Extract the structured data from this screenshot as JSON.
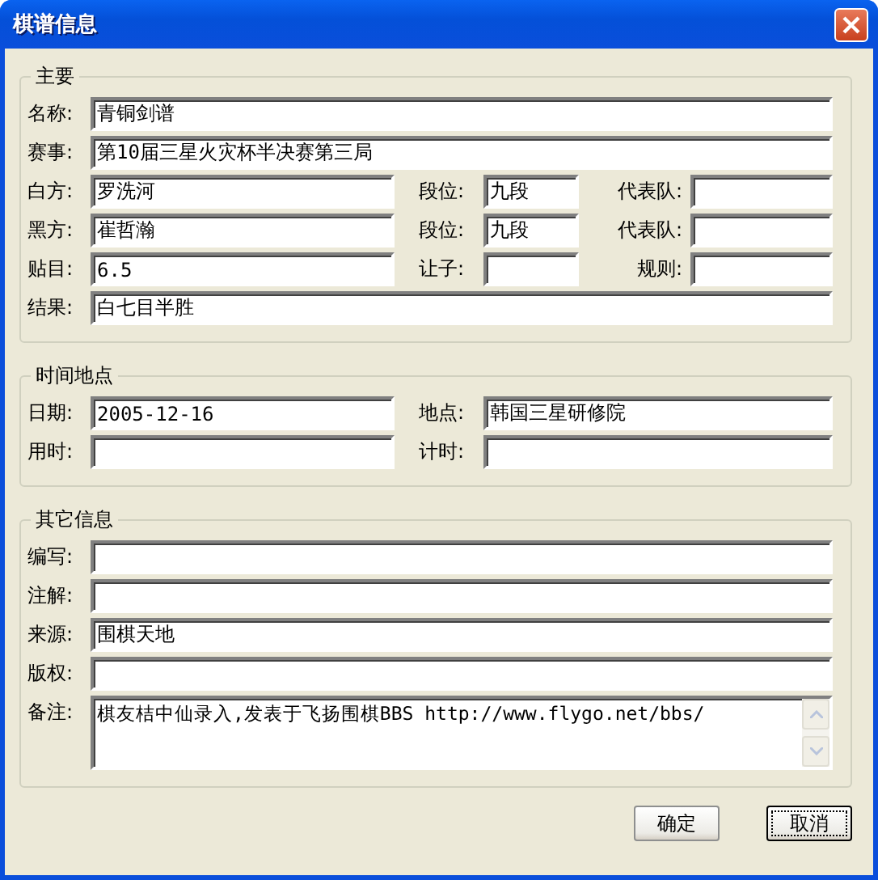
{
  "window": {
    "title": "棋谱信息"
  },
  "groups": [
    {
      "title": "主要",
      "rows": [
        {
          "fields": [
            {
              "label": "名称:",
              "value": "青铜剑谱"
            }
          ]
        },
        {
          "fields": [
            {
              "label": "赛事:",
              "value": "第10届三星火灾杯半决赛第三局"
            }
          ]
        },
        {
          "fields": [
            {
              "label": "白方:",
              "value": "罗洗河"
            },
            {
              "label": "段位:",
              "value": "九段"
            },
            {
              "label": "代表队:"
            }
          ]
        },
        {
          "fields": [
            {
              "label": "黑方:",
              "value": "崔哲瀚"
            },
            {
              "label": "段位:",
              "value": "九段"
            },
            {
              "label": "代表队:"
            }
          ]
        },
        {
          "fields": [
            {
              "label": "贴目:",
              "value": "6.5"
            },
            {
              "label": "让子:"
            },
            {
              "label": "规则:"
            }
          ]
        },
        {
          "fields": [
            {
              "label": "结果:",
              "value": "白七目半胜"
            }
          ]
        }
      ]
    },
    {
      "title": "时间地点",
      "rows": [
        {
          "fields": [
            {
              "label": "日期:",
              "value": "2005-12-16"
            },
            {
              "label": "地点:",
              "value": "韩国三星研修院"
            }
          ]
        },
        {
          "fields": [
            {
              "label": "用时:"
            },
            {
              "label": "计时:"
            }
          ]
        }
      ]
    },
    {
      "title": "其它信息",
      "rows": [
        {
          "fields": [
            {
              "label": "编写:"
            }
          ]
        },
        {
          "fields": [
            {
              "label": "注解:"
            }
          ]
        },
        {
          "fields": [
            {
              "label": "来源:",
              "value": "围棋天地"
            }
          ]
        },
        {
          "fields": [
            {
              "label": "版权:"
            }
          ]
        },
        {
          "fields": [
            {
              "label": "备注:",
              "value": "棋友桔中仙录入,发表于飞扬围棋BBS http://www.flygo.net/bbs/",
              "kind": "memo"
            }
          ]
        }
      ]
    }
  ],
  "buttons": [
    {
      "label": "确定",
      "focused": false
    },
    {
      "label": "取消",
      "focused": true
    }
  ]
}
